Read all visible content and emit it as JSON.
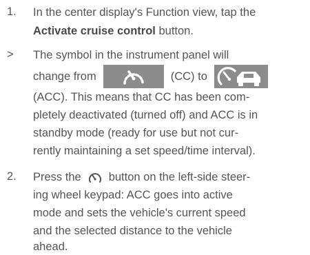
{
  "steps": [
    {
      "marker": "1.",
      "line1": "In the center display's Function view, tap the",
      "button_label": "Activate cruise control",
      "line2_suffix": " button."
    },
    {
      "marker": ">",
      "line1": "The symbol in the instrument panel will",
      "line2_prefix": "change from",
      "cc_label": "(CC) to",
      "line3": "(ACC). This means that CC has been com-",
      "line4": "pletely deactivated (turned off) and ACC is in",
      "line5": "standby mode (ready for use but not cur-",
      "line6": "rently maintaining a set speed/time interval)."
    },
    {
      "marker": "2.",
      "line1_prefix": "Press the",
      "line1_suffix": "button on the left-side steer-",
      "line2": "ing wheel keypad: ACC goes into active",
      "line3": "mode and sets the vehicle's current speed",
      "line4": "and the selected distance to the vehicle",
      "line5": "ahead."
    }
  ],
  "icons": {
    "cc_symbol": "cruise-control-speedometer-icon",
    "acc_symbol": "adaptive-cruise-control-car-icon",
    "keypad_button": "speedometer-button-icon"
  },
  "colors": {
    "text": "#555555",
    "icon_background": "#8c8c8c",
    "icon_foreground": "#ffffff"
  }
}
